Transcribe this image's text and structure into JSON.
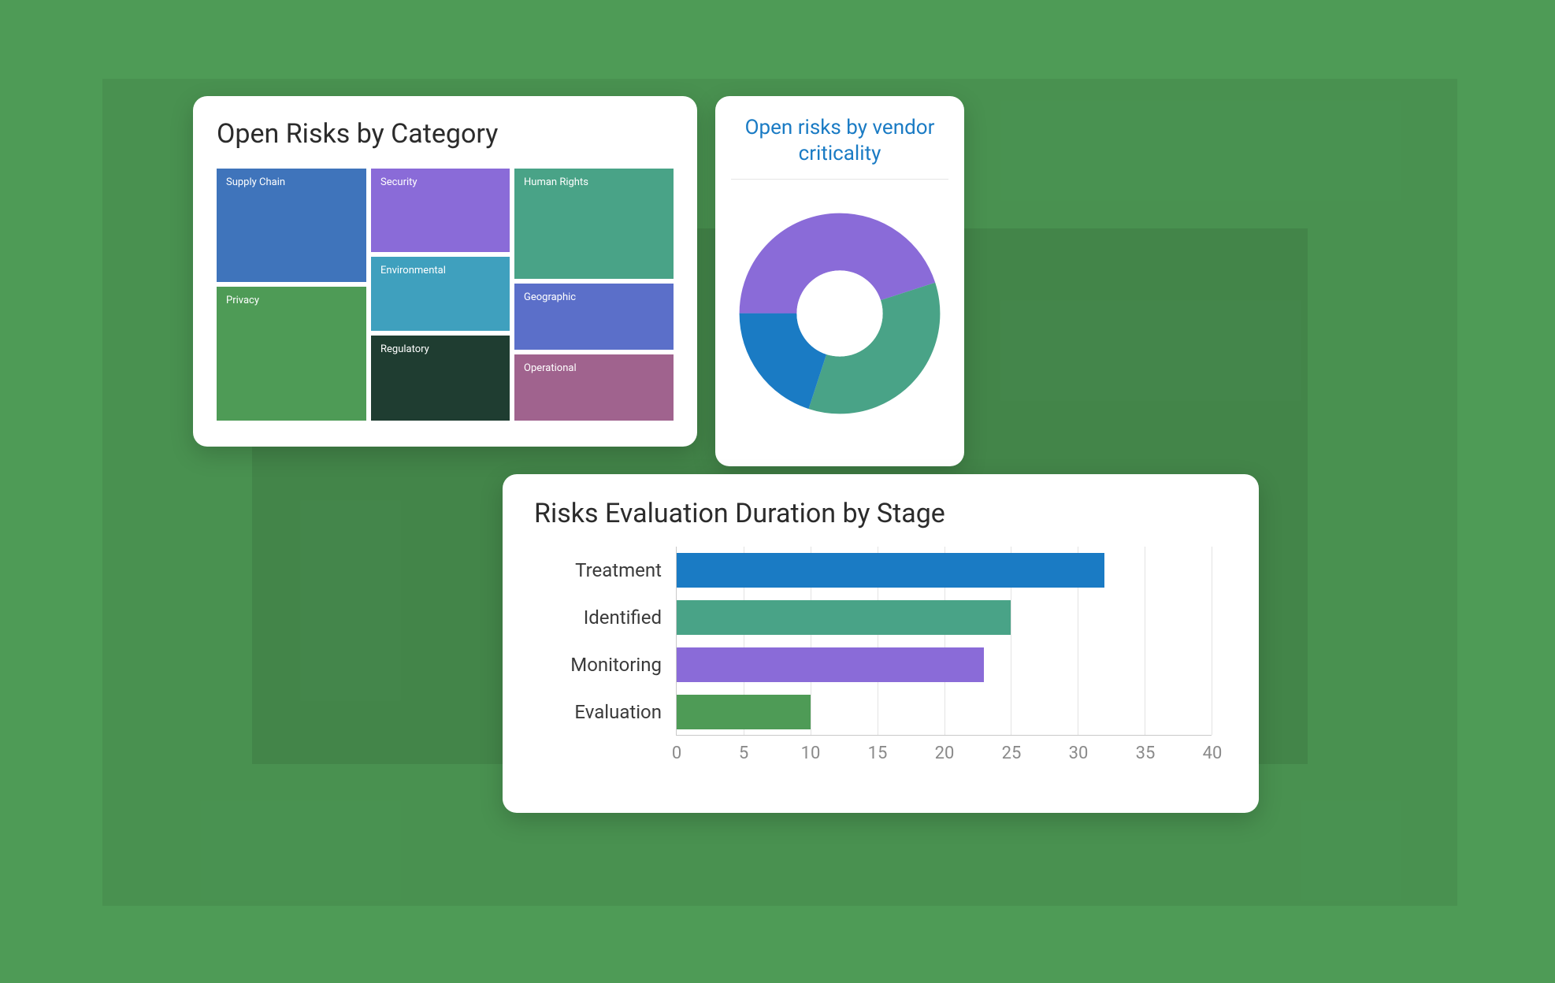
{
  "treemap": {
    "title": "Open Risks by Category",
    "tiles": {
      "supplychain": {
        "label": "Supply Chain",
        "area": 27360
      },
      "privacy": {
        "label": "Privacy",
        "area": 32300
      },
      "security": {
        "label": "Security",
        "area": 18656
      },
      "environmental": {
        "label": "Environmental",
        "area": 16544
      },
      "regulatory": {
        "label": "Regulatory",
        "area": 19008
      },
      "humanrights": {
        "label": "Human Rights",
        "area": 28280
      },
      "geographic": {
        "label": "Geographic",
        "area": 16968
      },
      "operational": {
        "label": "Operational",
        "area": 16968
      }
    }
  },
  "donut": {
    "title": "Open risks by vendor criticality"
  },
  "bar": {
    "title": "Risks Evaluation Duration by Stage",
    "series": {
      "treatment": {
        "label": "Treatment",
        "value": 32
      },
      "identified": {
        "label": "Identified",
        "value": 25
      },
      "monitoring": {
        "label": "Monitoring",
        "value": 23
      },
      "evaluation": {
        "label": "Evaluation",
        "value": 10
      }
    },
    "ticks": [
      "0",
      "5",
      "10",
      "15",
      "20",
      "25",
      "30",
      "35",
      "40"
    ]
  },
  "chart_data": [
    {
      "type": "treemap",
      "title": "Open Risks by Category",
      "categories": [
        "Supply Chain",
        "Privacy",
        "Security",
        "Environmental",
        "Regulatory",
        "Human Rights",
        "Geographic",
        "Operational"
      ],
      "values": [
        27360,
        32300,
        18656,
        16544,
        19008,
        28280,
        16968,
        16968
      ],
      "note": "Values are relative pixel areas (proxy for count); no numeric scale shown."
    },
    {
      "type": "pie",
      "title": "Open risks by vendor criticality",
      "categories": [
        "Purple",
        "Teal",
        "Blue"
      ],
      "values": [
        45,
        35,
        20
      ],
      "note": "Percentages estimated from arc lengths; slice labels not shown in image."
    },
    {
      "type": "bar",
      "title": "Risks Evaluation Duration by Stage",
      "orientation": "horizontal",
      "categories": [
        "Treatment",
        "Identified",
        "Monitoring",
        "Evaluation"
      ],
      "values": [
        32,
        25,
        23,
        10
      ],
      "xlabel": "",
      "ylabel": "",
      "xlim": [
        0,
        40
      ],
      "grid": true
    }
  ]
}
